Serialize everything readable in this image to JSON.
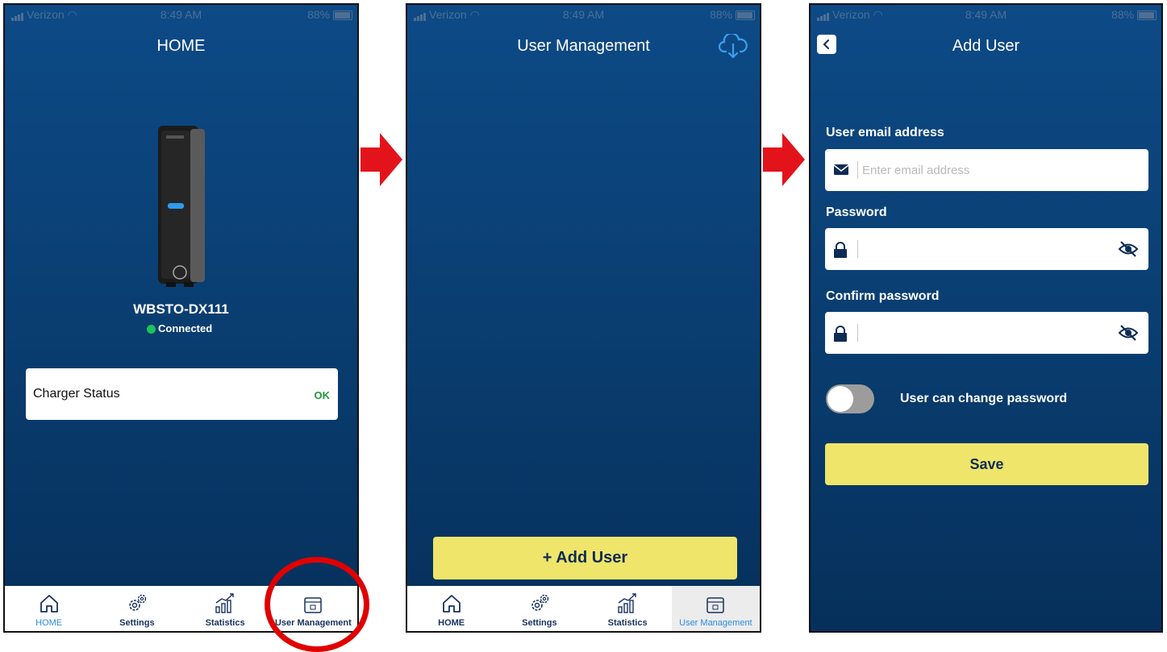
{
  "status_bar": {
    "carrier": "Verizon",
    "time": "8:49 AM",
    "battery": "88%"
  },
  "home": {
    "title": "HOME",
    "device_name": "WBSTO-DX111",
    "connection_status": "Connected",
    "charger_status_label": "Charger Status",
    "charger_status_value": "OK"
  },
  "tabs": [
    {
      "label": "HOME",
      "icon": "home-icon"
    },
    {
      "label": "Settings",
      "icon": "gear-icon"
    },
    {
      "label": "Statistics",
      "icon": "chart-icon"
    },
    {
      "label": "User Management",
      "icon": "user-management-icon"
    }
  ],
  "user_management": {
    "title": "User Management",
    "add_user_label": "+ Add User"
  },
  "add_user": {
    "title": "Add User",
    "email_label": "User email address",
    "email_placeholder": "Enter email address",
    "password_label": "Password",
    "confirm_password_label": "Confirm password",
    "toggle_label": "User can change password",
    "toggle_on": false,
    "save_label": "Save"
  },
  "colors": {
    "background": "#0a3f73",
    "accent_yellow": "#efe56a",
    "status_ok": "#1e9a3c",
    "connected": "#1fc25a",
    "annotation_red": "#e00000",
    "active_tab": "#2a8de0"
  }
}
